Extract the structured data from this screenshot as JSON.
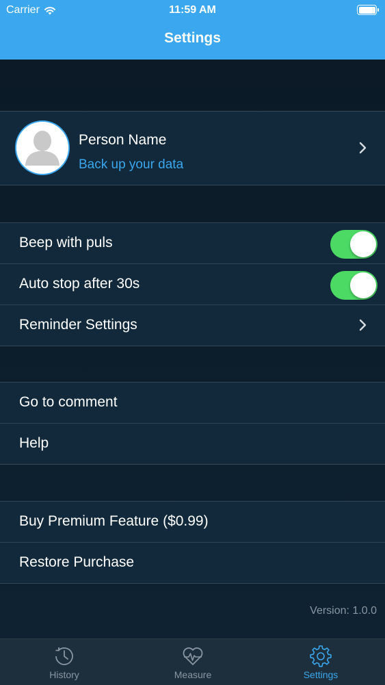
{
  "status_bar": {
    "carrier": "Carrier",
    "time": "11:59 AM"
  },
  "nav": {
    "title": "Settings"
  },
  "profile": {
    "name": "Person Name",
    "subtitle": "Back up your data"
  },
  "settings": {
    "beep_label": "Beep with puls",
    "beep_on": true,
    "autostop_label": "Auto stop after 30s",
    "autostop_on": true,
    "reminder_label": "Reminder Settings"
  },
  "support": {
    "comment_label": "Go to comment",
    "help_label": "Help"
  },
  "purchase": {
    "premium_label": "Buy Premium Feature ($0.99)",
    "restore_label": "Restore Purchase"
  },
  "version": "Version: 1.0.0",
  "tabs": [
    {
      "label": "History",
      "icon": "clock-icon",
      "active": false
    },
    {
      "label": "Measure",
      "icon": "heart-pulse-icon",
      "active": false
    },
    {
      "label": "Settings",
      "icon": "gear-icon",
      "active": true
    }
  ],
  "colors": {
    "accent": "#3aa7ee",
    "toggle_on": "#4cd964",
    "background": "#0b1a26"
  }
}
